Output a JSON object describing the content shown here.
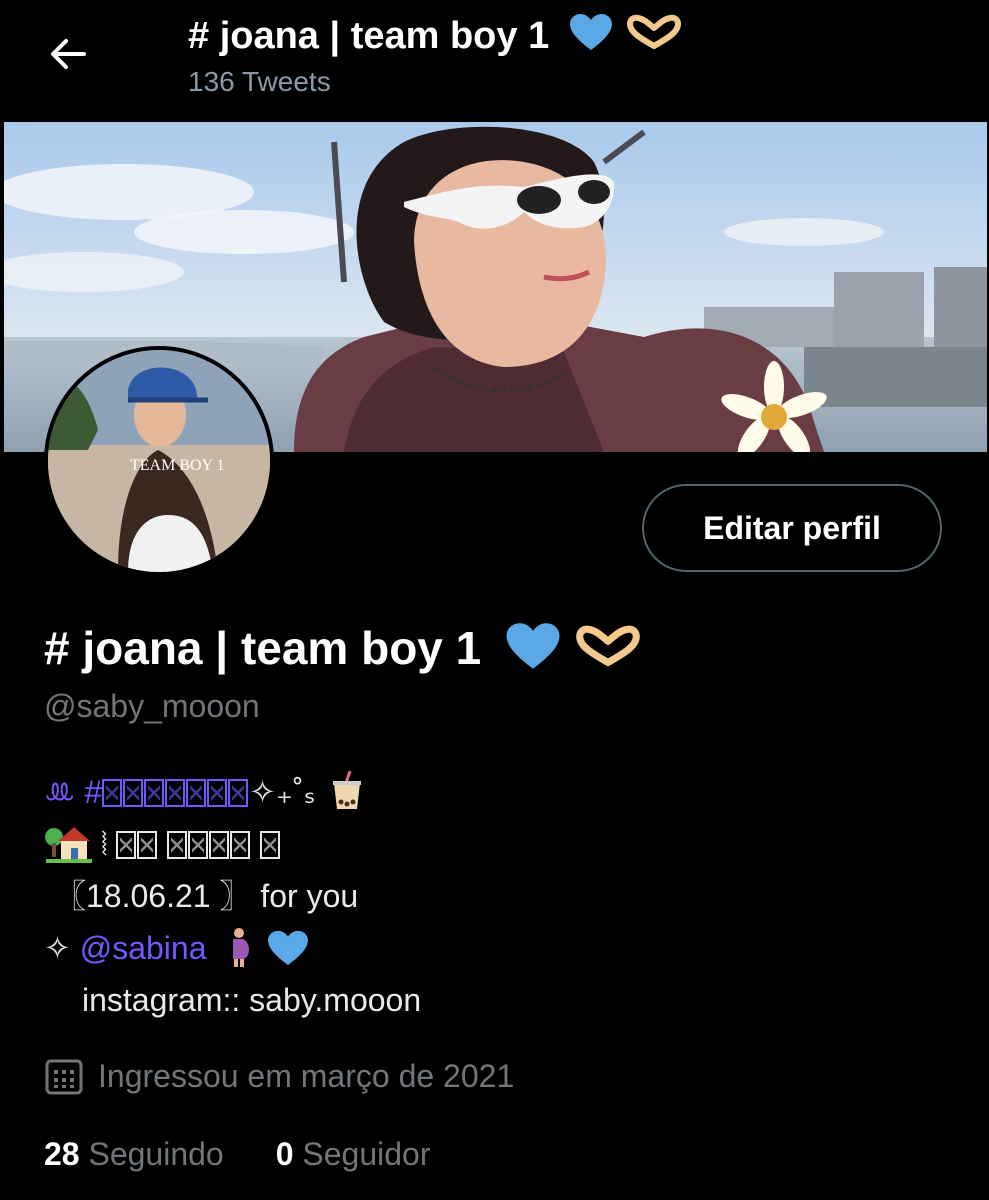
{
  "header": {
    "display_name": "# joana | team boy 1",
    "tweet_count": "136 Tweets",
    "icons": [
      "arrow-left-icon",
      "blue-heart-icon",
      "heart-hands-icon"
    ]
  },
  "profile": {
    "name": "# joana | team boy 1",
    "handle": "@saby_mooon",
    "edit_button": "Editar perfil",
    "avatar_overlay_text": "TEAM BOY 1"
  },
  "bio": {
    "line1_prefix": "ꔛ #",
    "line1_suffix": "✧₊˚ₛ",
    "line2_mark": "⦚",
    "line3": "〖18.06.21 〗 for you",
    "line4_prefix": "✧",
    "line4_mention": "@sabina",
    "line5": "instagram:: saby.mooon"
  },
  "meta": {
    "joined": "Ingressou em março de 2021"
  },
  "stats": {
    "following_count": "28",
    "following_label": "Seguindo",
    "followers_count": "0",
    "followers_label": "Seguidor"
  },
  "colors": {
    "background": "#000000",
    "accent_purple": "#7856ff",
    "muted": "#71767b",
    "heart_blue": "#5aa9e6"
  }
}
